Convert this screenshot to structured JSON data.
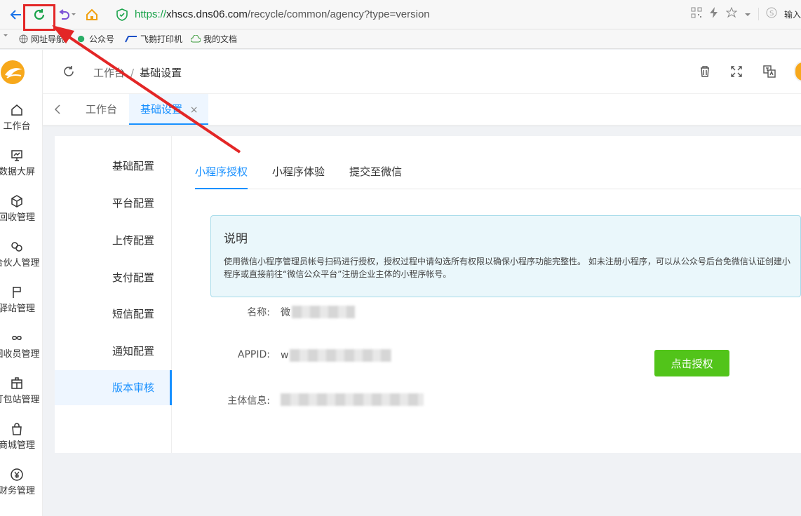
{
  "browser": {
    "url_scheme": "https://",
    "url_host": "xhscs.dns06.com",
    "url_path": "/recycle/common/agency?type=version",
    "right_text": "输入",
    "bookmarks": [
      "网址导航",
      "公众号",
      "飞鹅打印机",
      "我的文档"
    ]
  },
  "sidebar": {
    "items": [
      {
        "label": "工作台",
        "icon": "home-icon"
      },
      {
        "label": "数据大屏",
        "icon": "screen-icon"
      },
      {
        "label": "回收管理",
        "icon": "box-icon"
      },
      {
        "label": "合伙人管理",
        "icon": "link-icon"
      },
      {
        "label": "驿站管理",
        "icon": "flag-icon"
      },
      {
        "label": "回收员管理",
        "icon": "infinity-icon"
      },
      {
        "label": "打包站管理",
        "icon": "package-icon"
      },
      {
        "label": "商城管理",
        "icon": "bag-icon"
      },
      {
        "label": "财务管理",
        "icon": "yen-icon"
      }
    ]
  },
  "header": {
    "breadcrumb": [
      "工作台",
      "基础设置"
    ]
  },
  "tabs": [
    {
      "label": "工作台"
    },
    {
      "label": "基础设置",
      "close": "×"
    }
  ],
  "submenu": [
    "基础配置",
    "平台配置",
    "上传配置",
    "支付配置",
    "短信配置",
    "通知配置",
    "版本审核"
  ],
  "inner_tabs": [
    "小程序授权",
    "小程序体验",
    "提交至微信"
  ],
  "notice": {
    "title": "说明",
    "text": "使用微信小程序管理员帐号扫码进行授权，授权过程中请勾选所有权限以确保小程序功能完整性。 如未注册小程序，可以从公众号后台免微信认证创建小程序或直接前往“微信公众平台”注册企业主体的小程序帐号。"
  },
  "fields": [
    {
      "label": "名称:",
      "value_prefix": "微"
    },
    {
      "label": "APPID:",
      "value_prefix": "w"
    },
    {
      "label": "主体信息:",
      "value_prefix": ""
    }
  ],
  "auth_button": "点击授权",
  "colors": {
    "primary": "#1890ff",
    "success": "#52c41a",
    "annotation": "#e32626"
  }
}
